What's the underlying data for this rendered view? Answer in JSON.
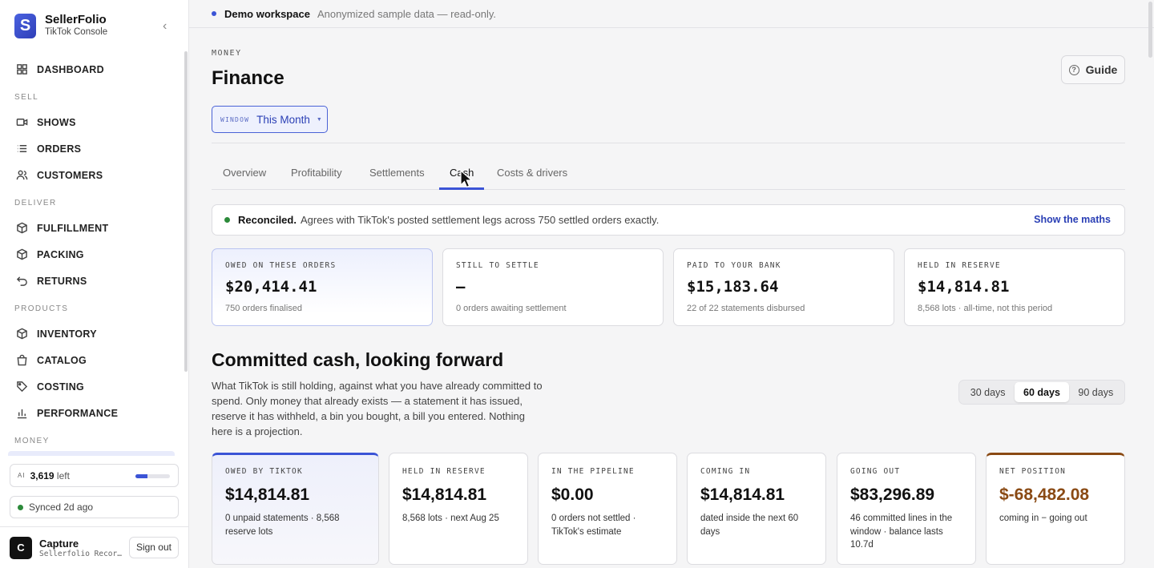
{
  "sidebar": {
    "brand_name": "SellerFolio",
    "brand_sub": "TikTok Console",
    "logo_letter": "S",
    "sections": {
      "sell": "SELL",
      "deliver": "DELIVER",
      "products": "PRODUCTS",
      "money": "MONEY"
    },
    "items": {
      "dashboard": "DASHBOARD",
      "shows": "SHOWS",
      "orders": "ORDERS",
      "customers": "CUSTOMERS",
      "fulfillment": "FULFILLMENT",
      "packing": "PACKING",
      "returns": "RETURNS",
      "inventory": "INVENTORY",
      "catalog": "CATALOG",
      "costing": "COSTING",
      "performance": "PERFORMANCE"
    },
    "ai": {
      "tag": "AI",
      "count": "3,619",
      "suffix": " left",
      "usage_fraction": 0.35
    },
    "sync": "Synced 2d ago",
    "user": {
      "initial": "C",
      "name": "Capture",
      "sub": "Sellerfolio Recor…",
      "signout": "Sign out"
    }
  },
  "banner": {
    "title": "Demo workspace",
    "note": "Anonymized sample data — read-only."
  },
  "header": {
    "eyebrow": "MONEY",
    "title": "Finance",
    "guide": "Guide"
  },
  "window": {
    "label": "WINDOW",
    "value": "This Month"
  },
  "tabs": [
    "Overview",
    "Profitability",
    "Settlements",
    "Cash",
    "Costs & drivers"
  ],
  "reconciled": {
    "title": "Reconciled.",
    "text": "Agrees with TikTok's posted settlement legs across 750 settled orders exactly.",
    "link": "Show the maths"
  },
  "stats": [
    {
      "label": "OWED ON THESE ORDERS",
      "value": "$20,414.41",
      "sub": "750 orders finalised"
    },
    {
      "label": "STILL TO SETTLE",
      "value": "—",
      "sub": "0 orders awaiting settlement"
    },
    {
      "label": "PAID TO YOUR BANK",
      "value": "$15,183.64",
      "sub": "22 of 22 statements disbursed"
    },
    {
      "label": "HELD IN RESERVE",
      "value": "$14,814.81",
      "sub": "8,568 lots · all-time, not this period"
    }
  ],
  "committed": {
    "title": "Committed cash, looking forward",
    "desc": "What TikTok is still holding, against what you have already committed to spend. Only money that already exists — a statement it has issued, reserve it has withheld, a bin you bought, a bill you entered. Nothing here is a projection.",
    "ranges": [
      "30 days",
      "60 days",
      "90 days"
    ],
    "selected_range": "60 days",
    "cards": [
      {
        "label": "OWED BY TIKTOK",
        "value": "$14,814.81",
        "sub": "0 unpaid statements · 8,568 reserve lots"
      },
      {
        "label": "HELD IN RESERVE",
        "value": "$14,814.81",
        "sub": "8,568 lots · next Aug 25"
      },
      {
        "label": "IN THE PIPELINE",
        "value": "$0.00",
        "sub": "0 orders not settled · TikTok's estimate"
      },
      {
        "label": "COMING IN",
        "value": "$14,814.81",
        "sub": "dated inside the next 60 days"
      },
      {
        "label": "GOING OUT",
        "value": "$83,296.89",
        "sub": "46 committed lines in the window · balance lasts 10.7d"
      },
      {
        "label": "NET POSITION",
        "value": "$-68,482.08",
        "sub": "coming in − going out"
      }
    ]
  },
  "colors": {
    "accent": "#3b54d6",
    "negative": "#8a4a14",
    "ok": "#2c8a3a"
  }
}
